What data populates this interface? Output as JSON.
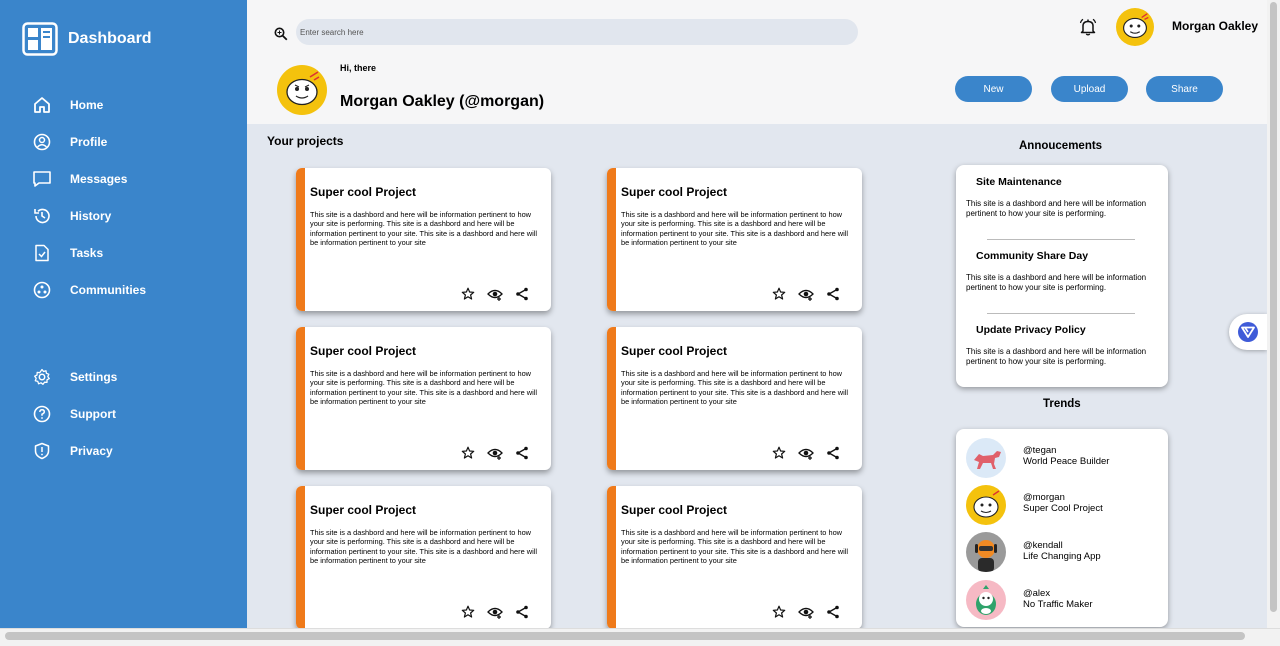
{
  "sidebar": {
    "brand": "Dashboard",
    "items": [
      {
        "label": "Home",
        "icon": "home-icon"
      },
      {
        "label": "Profile",
        "icon": "profile-icon"
      },
      {
        "label": "Messages",
        "icon": "messages-icon"
      },
      {
        "label": "History",
        "icon": "history-icon"
      },
      {
        "label": "Tasks",
        "icon": "tasks-icon"
      },
      {
        "label": "Communities",
        "icon": "communities-icon"
      },
      {
        "label": "Settings",
        "icon": "gear-icon"
      },
      {
        "label": "Support",
        "icon": "help-icon"
      },
      {
        "label": "Privacy",
        "icon": "shield-icon"
      }
    ]
  },
  "header": {
    "search_placeholder": "Enter search here",
    "user_name": "Morgan Oakley",
    "greeting": "Hi, there",
    "profile_name": "Morgan Oakley (@morgan)",
    "buttons": {
      "new": "New",
      "upload": "Upload",
      "share": "Share"
    }
  },
  "projects": {
    "title": "Your projects",
    "cards": [
      {
        "title": "Super cool Project",
        "desc": "This site is a dashbord and here will be information pertinent to how your site is performing. This site is a dashbord and here will be information pertinent to your site. This site is a dashbord and here will be information pertinent to your site"
      },
      {
        "title": "Super cool Project",
        "desc": "This site is a dashbord and here will be information pertinent to how your site is performing. This site is a dashbord and here will be information pertinent to your site. This site is a dashbord and here will be information pertinent to your site"
      },
      {
        "title": "Super cool Project",
        "desc": "This site is a dashbord and here will be information pertinent to how your site is performing. This site is a dashbord and here will be information pertinent to your site. This site is a dashbord and here will be information pertinent to your site"
      },
      {
        "title": "Super cool Project",
        "desc": "This site is a dashbord and here will be information pertinent to how your site is performing. This site is a dashbord and here will be information pertinent to your site. This site is a dashbord and here will be information pertinent to your site"
      },
      {
        "title": "Super cool Project",
        "desc": "This site is a dashbord and here will be information pertinent to how your site is performing. This site is a dashbord and here will be information pertinent to your site. This site is a dashbord and here will be information pertinent to your site"
      },
      {
        "title": "Super cool Project",
        "desc": "This site is a dashbord and here will be information pertinent to how your site is performing. This site is a dashbord and here will be information pertinent to your site. This site is a dashbord and here will be information pertinent to your site"
      }
    ]
  },
  "announcements": {
    "title": "Annoucements",
    "items": [
      {
        "title": "Site Maintenance",
        "desc": "This site is a dashbord and here will be information pertinent to how your site is performing."
      },
      {
        "title": "Community Share Day",
        "desc": "This site is a dashbord and here will be information pertinent to how your site is performing."
      },
      {
        "title": "Update Privacy Policy",
        "desc": "This site is a dashbord and here will be information pertinent to how your site is performing."
      }
    ]
  },
  "trends": {
    "title": "Trends",
    "items": [
      {
        "handle": "@tegan",
        "project": "World Peace Builder"
      },
      {
        "handle": "@morgan",
        "project": "Super Cool Project"
      },
      {
        "handle": "@kendall",
        "project": "Life Changing App"
      },
      {
        "handle": "@alex",
        "project": "No Traffic Maker"
      }
    ]
  },
  "colors": {
    "sidebar": "#3a85cb",
    "accent": "#ef7a1a",
    "main_bg": "#e2e7ef"
  }
}
